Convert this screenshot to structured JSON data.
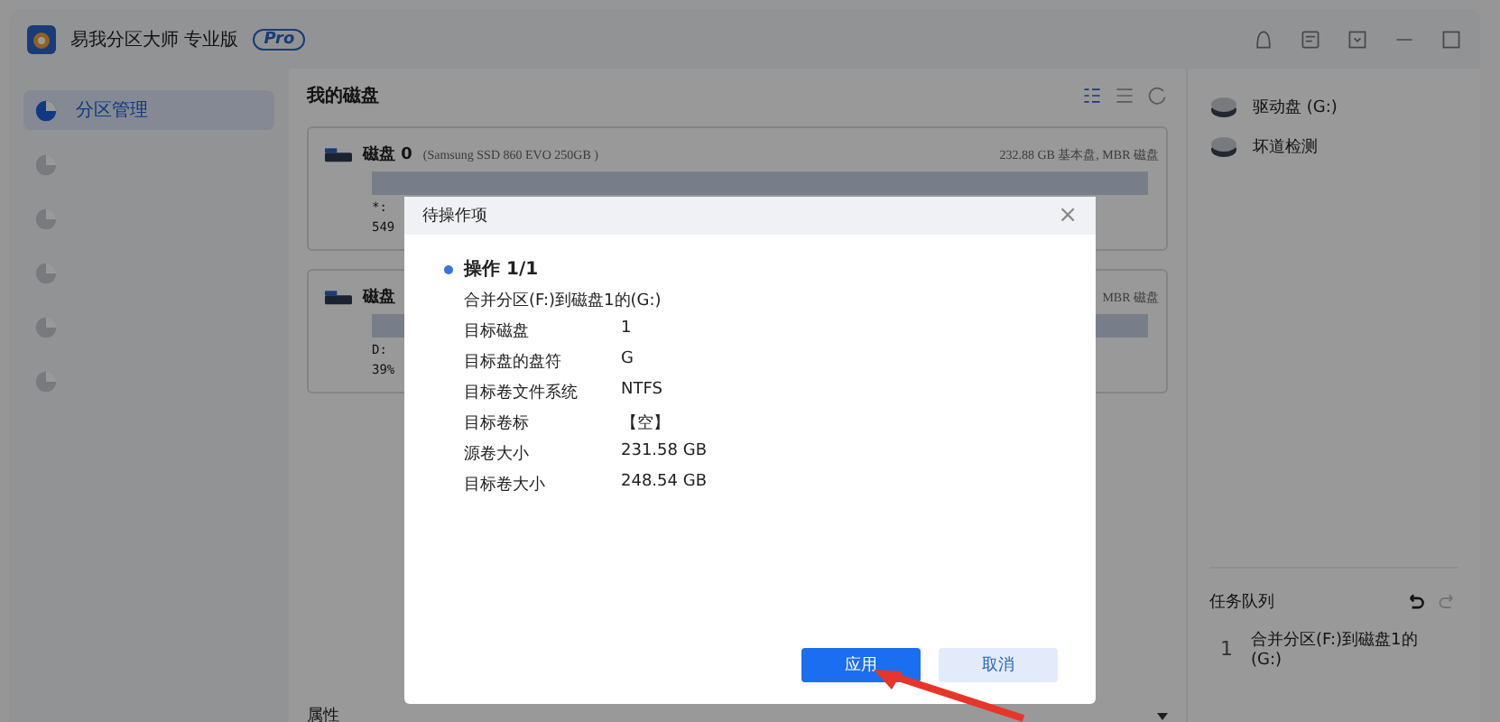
{
  "window": {
    "title": "易我分区大师 专业版",
    "badge": "Pro"
  },
  "sidebar": {
    "items": [
      {
        "label": "分区管理",
        "selected": true
      },
      {
        "selected": false
      },
      {
        "selected": false
      },
      {
        "selected": false
      },
      {
        "selected": false
      },
      {
        "selected": false
      }
    ]
  },
  "main": {
    "title": "我的磁盘",
    "disks": [
      {
        "name": "磁盘 0",
        "model": "(Samsung SSD 860 EVO 250GB )",
        "info": "232.88 GB 基本盘, MBR 磁盘",
        "part_label": "*:",
        "part_size": "549"
      },
      {
        "name": "磁盘",
        "info": "MBR 磁盘",
        "part_label": "D:",
        "part_size": "39%"
      }
    ],
    "footer": "属性"
  },
  "right": {
    "items": [
      {
        "label": "驱动盘 (G:)"
      },
      {
        "label": "坏道检测"
      }
    ],
    "queue": {
      "title": "任务队列",
      "tasks": [
        {
          "index": "1",
          "text": "合并分区(F:)到磁盘1的(G:)"
        }
      ]
    }
  },
  "dialog": {
    "title": "待操作项",
    "close": "×",
    "operation": "操作 1/1",
    "description": "合并分区(F:)到磁盘1的(G:)",
    "fields": [
      {
        "label": "目标磁盘",
        "value": "1"
      },
      {
        "label": "目标盘的盘符",
        "value": "G"
      },
      {
        "label": "目标卷文件系统",
        "value": "NTFS"
      },
      {
        "label": "目标卷标",
        "value": "【空】"
      },
      {
        "label": "源卷大小",
        "value": "231.58 GB"
      },
      {
        "label": "目标卷大小",
        "value": "248.54 GB"
      }
    ],
    "buttons": [
      {
        "label": "应用",
        "kind": "primary"
      },
      {
        "label": "取消",
        "kind": "secondary"
      }
    ]
  }
}
